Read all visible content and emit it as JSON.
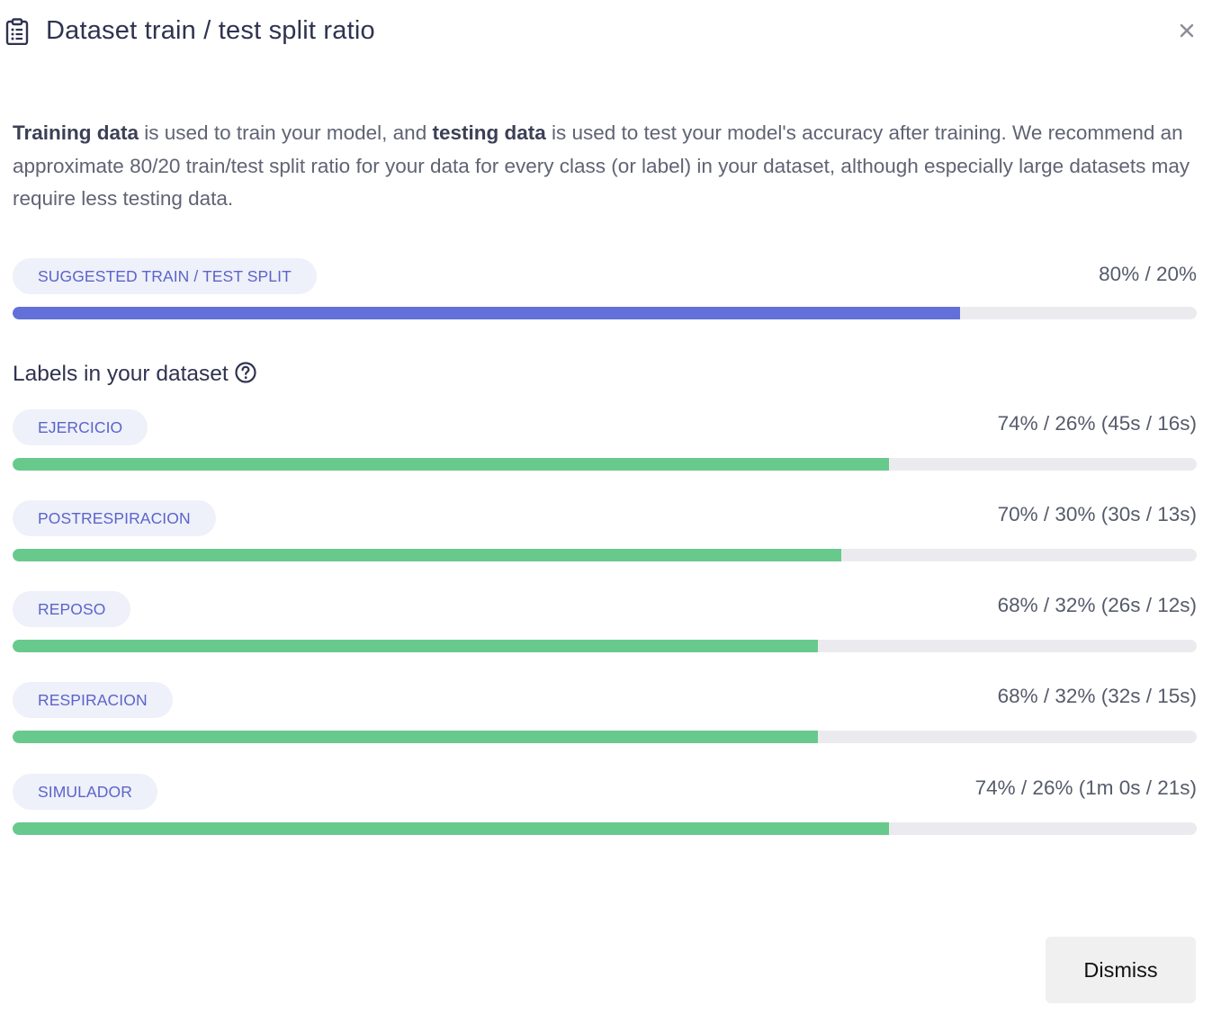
{
  "dialog": {
    "title": "Dataset train / test split ratio",
    "title_icon": "clipboard-list-icon",
    "close_icon": "close-icon"
  },
  "intro": {
    "training_bold": "Training data",
    "text_1": " is used to train your model, and ",
    "testing_bold": "testing data",
    "text_2": " is used to test your model's accuracy after training. We recommend an approximate 80/20 train/test split ratio for your data for every class (or label) in your dataset, although especially large datasets may require less testing data."
  },
  "suggested": {
    "label": "SUGGESTED TRAIN / TEST SPLIT",
    "ratio_text": "80% / 20%",
    "train_fraction": 0.8
  },
  "labels_section": {
    "heading": "Labels in your dataset",
    "help_icon": "question-circle-icon"
  },
  "labels": [
    {
      "name": "EJERCICIO",
      "ratio_text": "74% / 26% (45s / 16s)",
      "train_fraction": 0.74
    },
    {
      "name": "POSTRESPIRACION",
      "ratio_text": "70% / 30% (30s / 13s)",
      "train_fraction": 0.7
    },
    {
      "name": "REPOSO",
      "ratio_text": "68% / 32% (26s / 12s)",
      "train_fraction": 0.68
    },
    {
      "name": "RESPIRACION",
      "ratio_text": "68% / 32% (32s / 15s)",
      "train_fraction": 0.68
    },
    {
      "name": "SIMULADOR",
      "ratio_text": "74% / 26% (1m 0s / 21s)",
      "train_fraction": 0.74
    }
  ],
  "colors": {
    "suggested_bar": "#6370d9",
    "label_bar": "#68c98d",
    "track": "#ebebef",
    "pill_bg": "#eef0fa",
    "pill_text": "#5b64c9"
  },
  "actions": {
    "dismiss_label": "Dismiss"
  }
}
